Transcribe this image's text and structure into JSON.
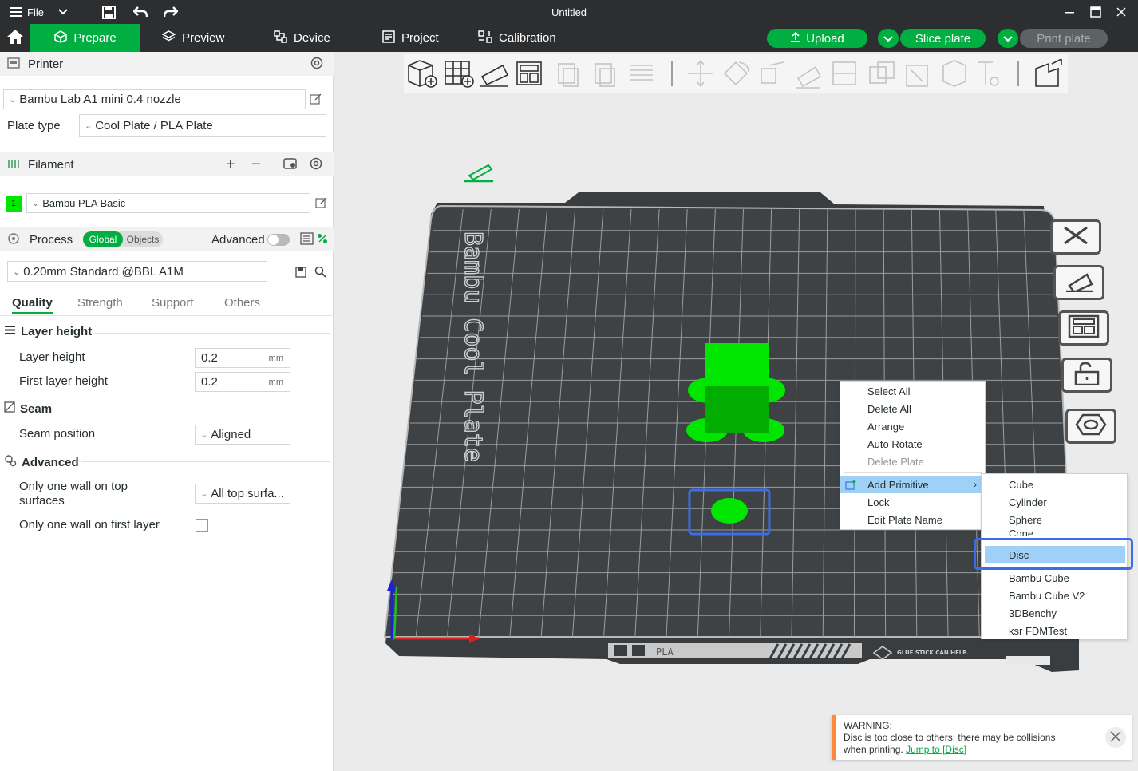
{
  "window": {
    "title": "Untitled",
    "file_menu_label": "File"
  },
  "tabs": [
    {
      "label": "Prepare"
    },
    {
      "label": "Preview"
    },
    {
      "label": "Device"
    },
    {
      "label": "Project"
    },
    {
      "label": "Calibration"
    }
  ],
  "actions": {
    "upload": "Upload",
    "slice_plate": "Slice plate",
    "print_plate": "Print plate"
  },
  "printer": {
    "section_label": "Printer",
    "selected": "Bambu Lab A1 mini 0.4 nozzle",
    "plate_type_label": "Plate type",
    "plate_type": "Cool Plate / PLA Plate"
  },
  "filament": {
    "section_label": "Filament",
    "slot_number": "1",
    "slot_color": "#00e600",
    "selected": "Bambu PLA Basic"
  },
  "process": {
    "section_label": "Process",
    "toggle_global": "Global",
    "toggle_objects": "Objects",
    "advanced_label": "Advanced",
    "advanced_enabled": false,
    "profile": "0.20mm Standard @BBL A1M",
    "subtabs": [
      "Quality",
      "Strength",
      "Support",
      "Others"
    ],
    "active_subtab": "Quality",
    "groups": {
      "layer_height": {
        "title": "Layer height",
        "layer_height_label": "Layer height",
        "layer_height_value": "0.2",
        "first_layer_height_label": "First layer height",
        "first_layer_height_value": "0.2",
        "unit": "mm"
      },
      "seam": {
        "title": "Seam",
        "seam_position_label": "Seam position",
        "seam_position_value": "Aligned"
      },
      "advanced": {
        "title": "Advanced",
        "one_wall_top_label_1": "Only one wall on top",
        "one_wall_top_label_2": "surfaces",
        "one_wall_top_value": "All top surfa...",
        "one_wall_first_label": "Only one wall on first layer",
        "one_wall_first_checked": false
      }
    }
  },
  "plate": {
    "name_label": "Bambu Cool Plate",
    "bottom_label": "PLA",
    "bottom_note": "GLUE STICK CAN HELP."
  },
  "context_menu": {
    "items": [
      "Select All",
      "Delete All",
      "Arrange",
      "Auto Rotate",
      "Delete Plate",
      "Add Primitive",
      "Lock",
      "Edit Plate Name"
    ],
    "disabled_item": "Delete Plate",
    "highlighted_item": "Add Primitive"
  },
  "submenu": {
    "items": [
      "Cube",
      "Cylinder",
      "Sphere",
      "Cone",
      "Disc",
      "Bambu Cube",
      "Bambu Cube V2",
      "3DBenchy",
      "ksr FDMTest"
    ],
    "highlighted_item": "Disc"
  },
  "warning": {
    "title": "WARNING:",
    "message_1": "Disc is too close to others; there may be collisions",
    "message_2": "when printing.",
    "link": "Jump to [Disc]"
  },
  "colors": {
    "accent_green": "#00ae42",
    "model_green": "#00e600",
    "selection_blue": "#3a6ee8",
    "dark_bar": "#2c2e30"
  }
}
